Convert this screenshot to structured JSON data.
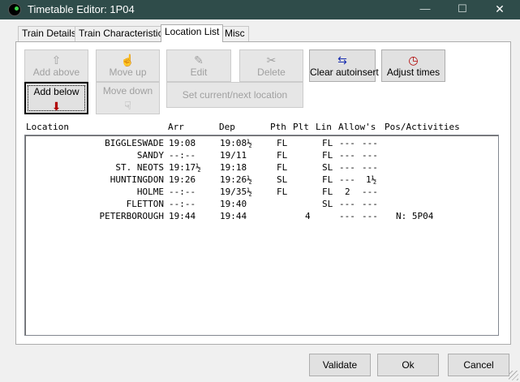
{
  "window": {
    "title": "Timetable Editor: 1P04",
    "controls": {
      "minimize": "—",
      "maximize": "☐",
      "close": "✕"
    }
  },
  "tabs": [
    {
      "label": "Train Details"
    },
    {
      "label": "Train Characteristics"
    },
    {
      "label": "Location List",
      "active": true
    },
    {
      "label": "Misc"
    }
  ],
  "toolbar": {
    "add_above": {
      "label": "Add above",
      "icon": "up-arrow-icon",
      "glyph": "⇧",
      "enabled": false
    },
    "move_up": {
      "label": "Move up",
      "icon": "hand-up-icon",
      "glyph": "☝",
      "enabled": false
    },
    "edit": {
      "label": "Edit",
      "icon": "document-edit-icon",
      "glyph": "✎",
      "enabled": false
    },
    "delete": {
      "label": "Delete",
      "icon": "delete-icon",
      "glyph": "✂",
      "enabled": false
    },
    "clear_autoinsert": {
      "label": "Clear autoinsert",
      "icon": "clear-autoinsert-icon",
      "glyph": "⇆",
      "enabled": true
    },
    "adjust_times": {
      "label": "Adjust times",
      "icon": "clock-icon",
      "glyph": "◷",
      "enabled": true
    },
    "add_below": {
      "label": "Add below",
      "icon": "down-arrow-icon",
      "glyph": "⬇",
      "enabled": true
    },
    "move_down": {
      "label": "Move down",
      "icon": "hand-down-icon",
      "glyph": "☟",
      "enabled": false
    },
    "set_current_next": {
      "label": "Set current/next location",
      "enabled": false
    }
  },
  "list": {
    "headers": {
      "location": "Location",
      "arr": "Arr",
      "dep": "Dep",
      "pth": "Pth",
      "plt": "Plt",
      "lin": "Lin",
      "allows": "Allow's",
      "pos_activities": "Pos/Activities"
    },
    "rows": [
      {
        "location": "BIGGLESWADE",
        "arr": "19:08",
        "dep": "19:08½",
        "pth": "FL",
        "plt": "",
        "lin": "FL",
        "allow1": "---",
        "allow2": "---",
        "pos": ""
      },
      {
        "location": "SANDY",
        "arr": "--:--",
        "dep": "19/11",
        "pth": "FL",
        "plt": "",
        "lin": "FL",
        "allow1": "---",
        "allow2": "---",
        "pos": ""
      },
      {
        "location": "ST. NEOTS",
        "arr": "19:17½",
        "dep": "19:18",
        "pth": "FL",
        "plt": "",
        "lin": "SL",
        "allow1": "---",
        "allow2": "---",
        "pos": ""
      },
      {
        "location": "HUNTINGDON",
        "arr": "19:26",
        "dep": "19:26½",
        "pth": "SL",
        "plt": "",
        "lin": "FL",
        "allow1": "---",
        "allow2": "1½",
        "pos": ""
      },
      {
        "location": "HOLME",
        "arr": "--:--",
        "dep": "19/35½",
        "pth": "FL",
        "plt": "",
        "lin": "FL",
        "allow1": "2",
        "allow2": "---",
        "pos": ""
      },
      {
        "location": "FLETTON",
        "arr": "--:--",
        "dep": "19:40",
        "pth": "",
        "plt": "",
        "lin": "SL",
        "allow1": "---",
        "allow2": "---",
        "pos": ""
      },
      {
        "location": "PETERBOROUGH",
        "arr": "19:44",
        "dep": "19:44",
        "pth": "",
        "plt": "4",
        "lin": "",
        "allow1": "---",
        "allow2": "---",
        "pos": "N: 5P04"
      }
    ]
  },
  "dialog_buttons": {
    "validate": "Validate",
    "ok": "Ok",
    "cancel": "Cancel"
  }
}
